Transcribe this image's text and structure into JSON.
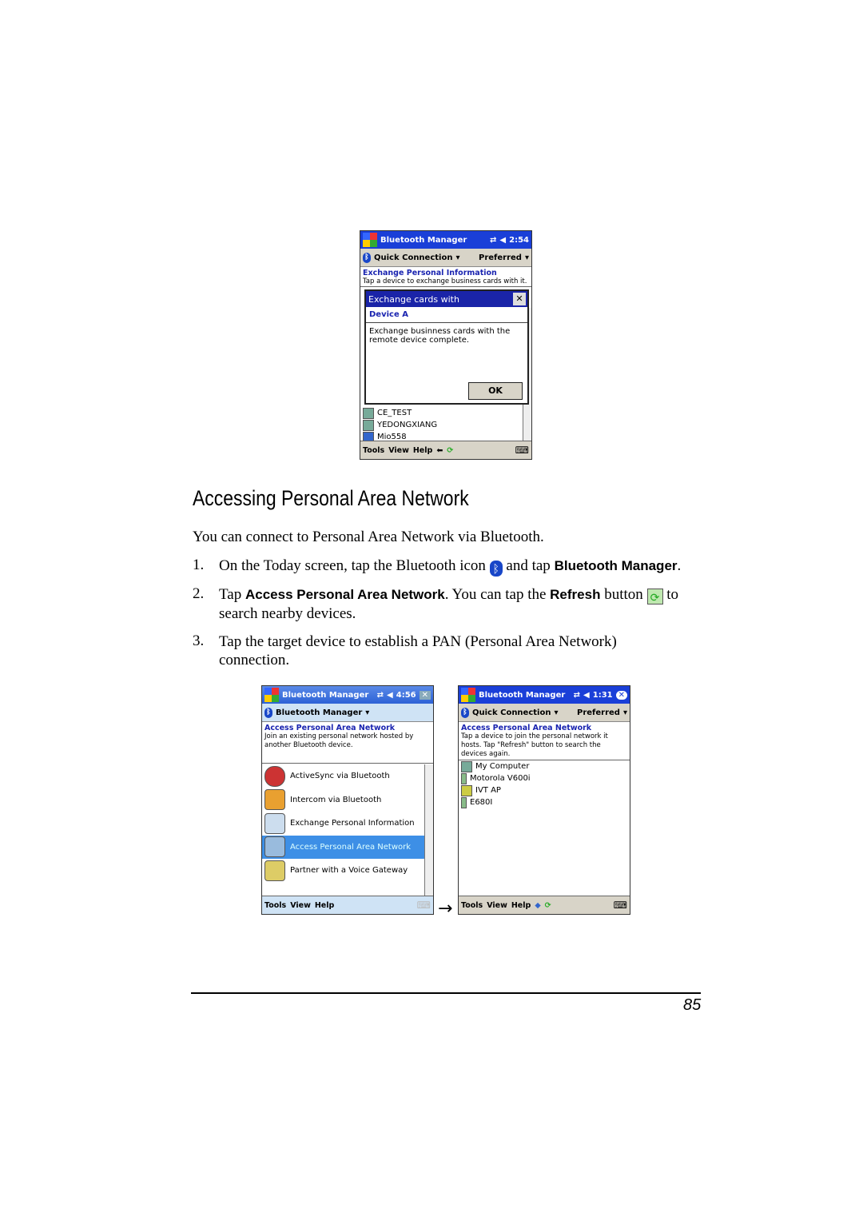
{
  "screen1": {
    "title": "Bluetooth Manager",
    "time": "2:54",
    "cmd_left": "Quick Connection",
    "cmd_right": "Preferred",
    "heading": "Exchange Personal Information",
    "desc": "Tap a device to exchange business cards with it.",
    "dialog": {
      "title": "Exchange cards with",
      "close": "✕",
      "device": "Device A",
      "message": "Exchange businness cards with the remote device complete.",
      "ok": "OK"
    },
    "devices": [
      "CE_TEST",
      "YEDONGXIANG",
      "Mio558"
    ],
    "menu": [
      "Tools",
      "View",
      "Help"
    ]
  },
  "section": {
    "title": "Accessing Personal Area Network",
    "intro": "You can connect to Personal Area Network via Bluetooth.",
    "steps": [
      {
        "num": "1.",
        "a": "On the Today screen, tap the Bluetooth icon",
        "b": "and tap",
        "bold": "Bluetooth Manager",
        "c": "."
      },
      {
        "num": "2.",
        "a": "Tap",
        "bold1": "Access Personal Area Network",
        "b": ". You can tap the",
        "bold2": "Refresh",
        "c": "button",
        "d": "to",
        "e": "search nearby devices."
      },
      {
        "num": "3.",
        "a": "Tap the target device to establish a PAN (Personal Area Network)",
        "b": "connection."
      }
    ]
  },
  "screen2": {
    "title": "Bluetooth Manager",
    "time": "4:56",
    "cmd": "Bluetooth Manager",
    "heading": "Access Personal Area Network",
    "desc": "Join an existing personal network hosted by another Bluetooth device.",
    "items": [
      "ActiveSync via Bluetooth",
      "Intercom via Bluetooth",
      "Exchange Personal Information",
      "Access Personal Area Network",
      "Partner with a Voice Gateway"
    ],
    "selected": "Access Personal Area Network",
    "menu": [
      "Tools",
      "View",
      "Help"
    ]
  },
  "arrow": "→",
  "screen3": {
    "title": "Bluetooth Manager",
    "time": "1:31",
    "cmd_left": "Quick Connection",
    "cmd_right": "Preferred",
    "heading": "Access Personal Area Network",
    "desc": "Tap a device to join the personal network it hosts. Tap \"Refresh\" button to search the devices again.",
    "devices": [
      "My Computer",
      "Motorola V600i",
      "IVT AP",
      "E680I"
    ],
    "menu": [
      "Tools",
      "View",
      "Help"
    ]
  },
  "footer": {
    "page_number": "85"
  },
  "colors": {
    "title_bar": "#1a3fd8",
    "selection": "#3d8fe6",
    "heading_blue": "#1a24b0"
  }
}
